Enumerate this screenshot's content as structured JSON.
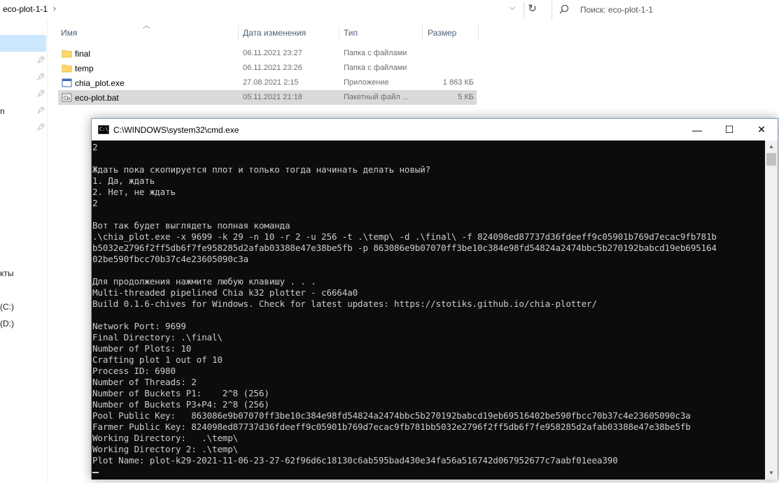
{
  "explorer": {
    "breadcrumb": "eco-plot-1-1",
    "search_placeholder": "Поиск: eco-plot-1-1",
    "nav_labels": [
      "n",
      "кты",
      "(C:)",
      "(D:)"
    ],
    "columns": {
      "name": "Имя",
      "date": "Дата изменения",
      "type": "Тип",
      "size": "Размер"
    },
    "files": [
      {
        "name": "final",
        "date": "06.11.2021 23:27",
        "type": "Папка с файлами",
        "size": "",
        "icon": "folder-icon"
      },
      {
        "name": "temp",
        "date": "06.11.2021 23:26",
        "type": "Папка с файлами",
        "size": "",
        "icon": "folder-icon"
      },
      {
        "name": "chia_plot.exe",
        "date": "27.08.2021 2:15",
        "type": "Приложение",
        "size": "1 863 КБ",
        "icon": "exe-icon"
      },
      {
        "name": "eco-plot.bat",
        "date": "05.11.2021 21:18",
        "type": "Пакетный файл ...",
        "size": "5 КБ",
        "icon": "bat-file-icon"
      }
    ]
  },
  "cmd": {
    "title": "C:\\WINDOWS\\system32\\cmd.exe",
    "icon_text": "C:\\",
    "min_glyph": "—",
    "max_glyph": "☐",
    "close_glyph": "✕",
    "console_lines": [
      "2",
      "",
      "Ждать пока скопируется плот и только тогда начинать делать новый?",
      "1. Да, ждать",
      "2. Нет, не ждать",
      "2",
      "",
      "Вот так будет выглядеть полная команда",
      ".\\chia_plot.exe -x 9699 -k 29 -n 10 -r 2 -u 256 -t .\\temp\\ -d .\\final\\ -f 824098ed87737d36fdeeff9c05901b769d7ecac9fb781b",
      "b5032e2796f2ff5db6f7fe958285d2afab03388e47e38be5fb -p 863086e9b07070ff3be10c384e98fd54824a2474bbc5b270192babcd19eb695164",
      "02be590fbcc70b37c4e23605090c3a",
      "",
      "Для продолжения нажмите любую клавишу . . .",
      "Multi-threaded pipelined Chia k32 plotter - c6664a0",
      "Build 0.1.6-chives for Windows. Check for latest updates: https://stotiks.github.io/chia-plotter/",
      "",
      "Network Port: 9699",
      "Final Directory: .\\final\\",
      "Number of Plots: 10",
      "Crafting plot 1 out of 10",
      "Process ID: 6980",
      "Number of Threads: 2",
      "Number of Buckets P1:    2^8 (256)",
      "Number of Buckets P3+P4: 2^8 (256)",
      "Pool Public Key:   863086e9b07070ff3be10c384e98fd54824a2474bbc5b270192babcd19eb69516402be590fbcc70b37c4e23605090c3a",
      "Farmer Public Key: 824098ed87737d36fdeeff9c05901b769d7ecac9fb781bb5032e2796f2ff5db6f7fe958285d2afab03388e47e38be5fb",
      "Working Directory:   .\\temp\\",
      "Working Directory 2: .\\temp\\",
      "Plot Name: plot-k29-2021-11-06-23-27-62f96d6c18130c6ab595bad430e34fa56a516742d067952677c7aabf01eea390"
    ]
  },
  "colors": {
    "console_bg": "#0c0c0c",
    "console_text": "#cccccc",
    "selection": "#cce8ff",
    "row_selected": "#d9d9d9",
    "folder": "#ffd766"
  }
}
